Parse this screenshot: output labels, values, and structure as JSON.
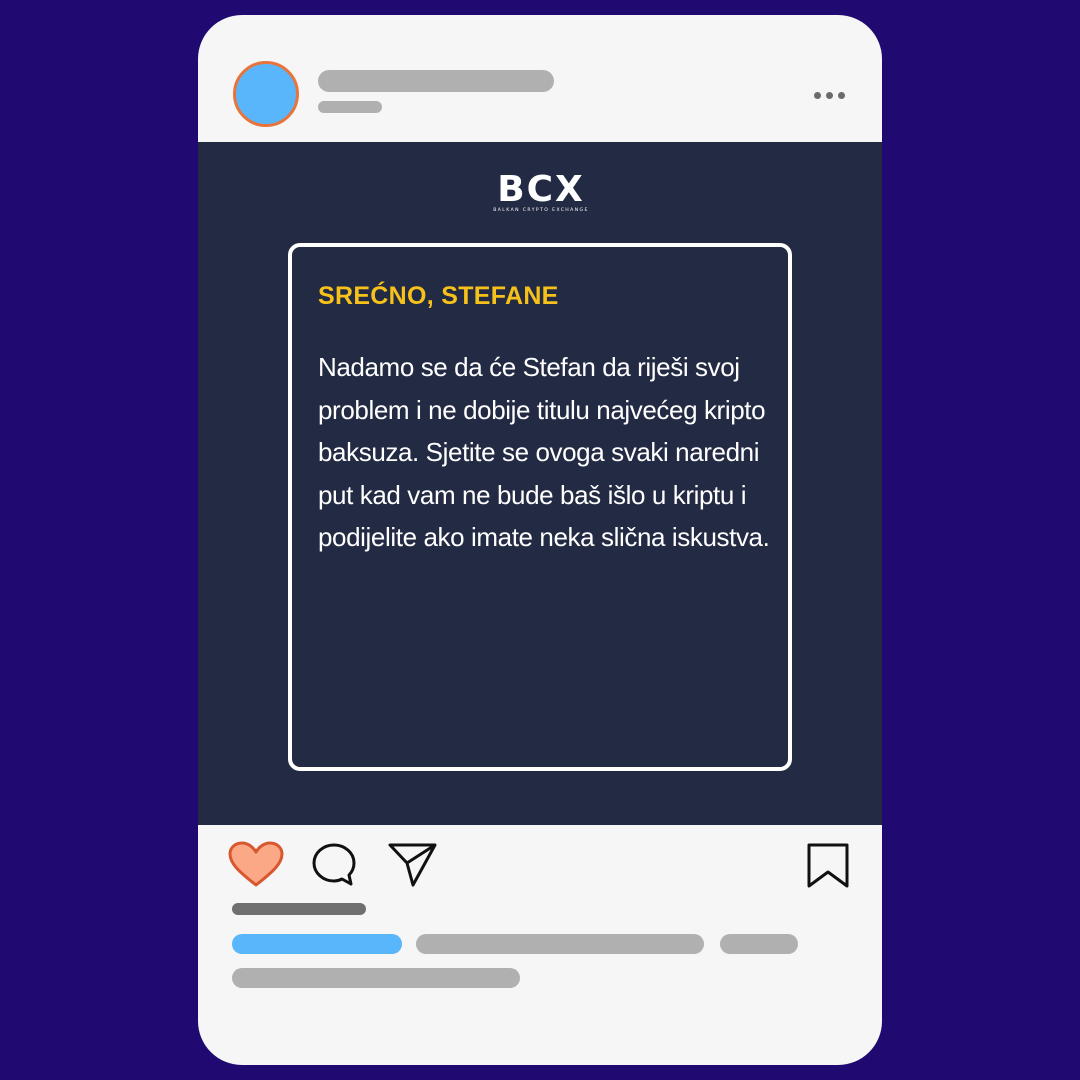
{
  "post": {
    "logo_text": "BCX",
    "logo_subtext": "BALKAN CRYPTO EXCHANGE",
    "card_title": "SREĆNO, STEFANE",
    "card_body": "Nadamo se da će Stefan da riješi svoj problem i ne dobije titulu najvećeg kripto baksuza. Sjetite se ovoga svaki naredni put kad vam ne bude baš išlo u kriptu i podijelite ako imate neka slična iskustva."
  },
  "icons": {
    "like": "heart-icon",
    "comment": "comment-icon",
    "share": "send-icon",
    "save": "bookmark-icon",
    "more": "more-dots-icon"
  },
  "colors": {
    "background": "#200a72",
    "post_background": "#232a43",
    "title": "#f6c11a",
    "avatar_fill": "#59b6fb",
    "avatar_ring": "#e8743c",
    "heart_fill": "#fba887",
    "heart_stroke": "#d7582e",
    "highlight_bar": "#59b6fb"
  }
}
